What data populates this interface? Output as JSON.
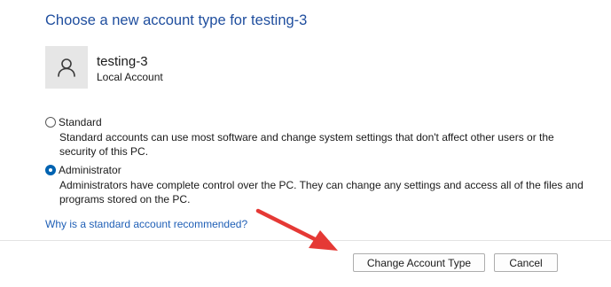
{
  "heading": "Choose a new account type for testing-3",
  "account": {
    "name": "testing-3",
    "type": "Local Account",
    "avatar_icon": "person-icon"
  },
  "options": [
    {
      "label": "Standard",
      "description": "Standard accounts can use most software and change system settings that don't affect other users or the security of this PC.",
      "selected": false
    },
    {
      "label": "Administrator",
      "description": "Administrators have complete control over the PC. They can change any settings and access all of the files and programs stored on the PC.",
      "selected": true
    }
  ],
  "help_link": "Why is a standard account recommended?",
  "buttons": {
    "change": "Change Account Type",
    "cancel": "Cancel"
  },
  "colors": {
    "heading": "#1f4e9e",
    "link": "#1f5fb6",
    "radio_selected": "#0063b1",
    "annotation_arrow": "#e53935"
  },
  "annotation": {
    "arrow_icon": "red-arrow-icon"
  }
}
